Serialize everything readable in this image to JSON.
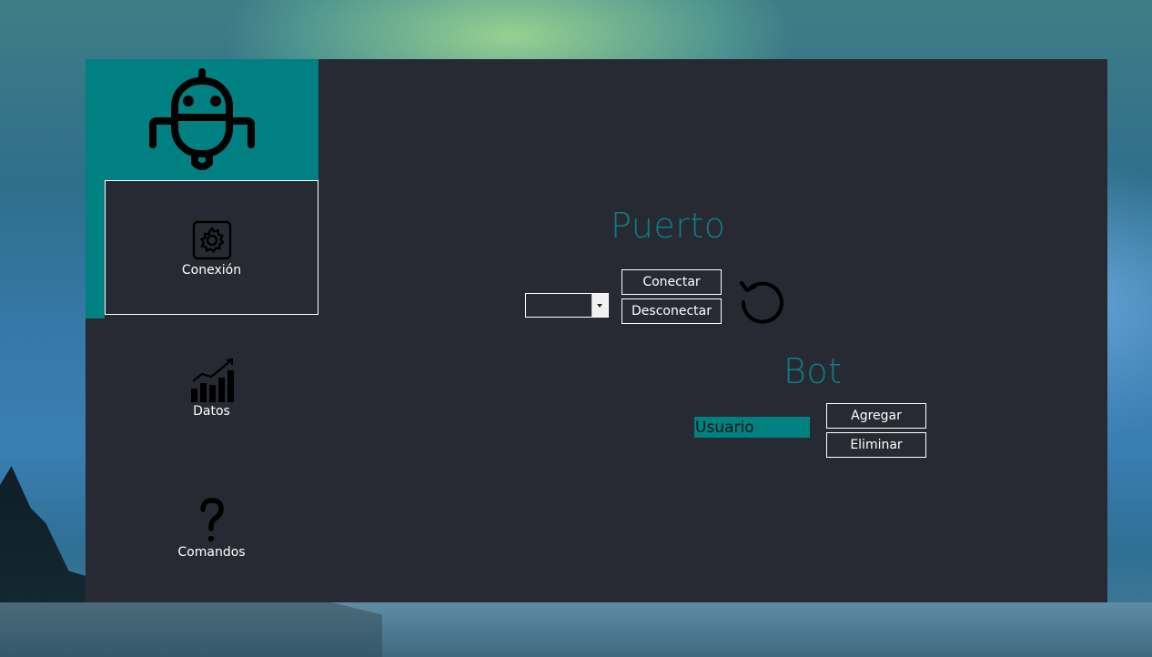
{
  "sidebar": {
    "logo_icon": "robot-icon",
    "items": [
      {
        "label": "Conexión",
        "icon": "gear-icon",
        "active": true
      },
      {
        "label": "Datos",
        "icon": "chart-icon",
        "active": false
      },
      {
        "label": "Comandos",
        "icon": "question-icon",
        "active": false
      }
    ]
  },
  "port_section": {
    "title": "Puerto",
    "port_select_value": "",
    "connect_label": "Conectar",
    "disconnect_label": "Desconectar",
    "refresh_icon": "refresh-icon"
  },
  "bot_section": {
    "title": "Bot",
    "user_value": "Usuario",
    "add_label": "Agregar",
    "remove_label": "Eliminar"
  },
  "colors": {
    "accent": "#008080",
    "panel_bg": "#282a33",
    "heading": "#0b7f86",
    "text": "#ffffff"
  }
}
